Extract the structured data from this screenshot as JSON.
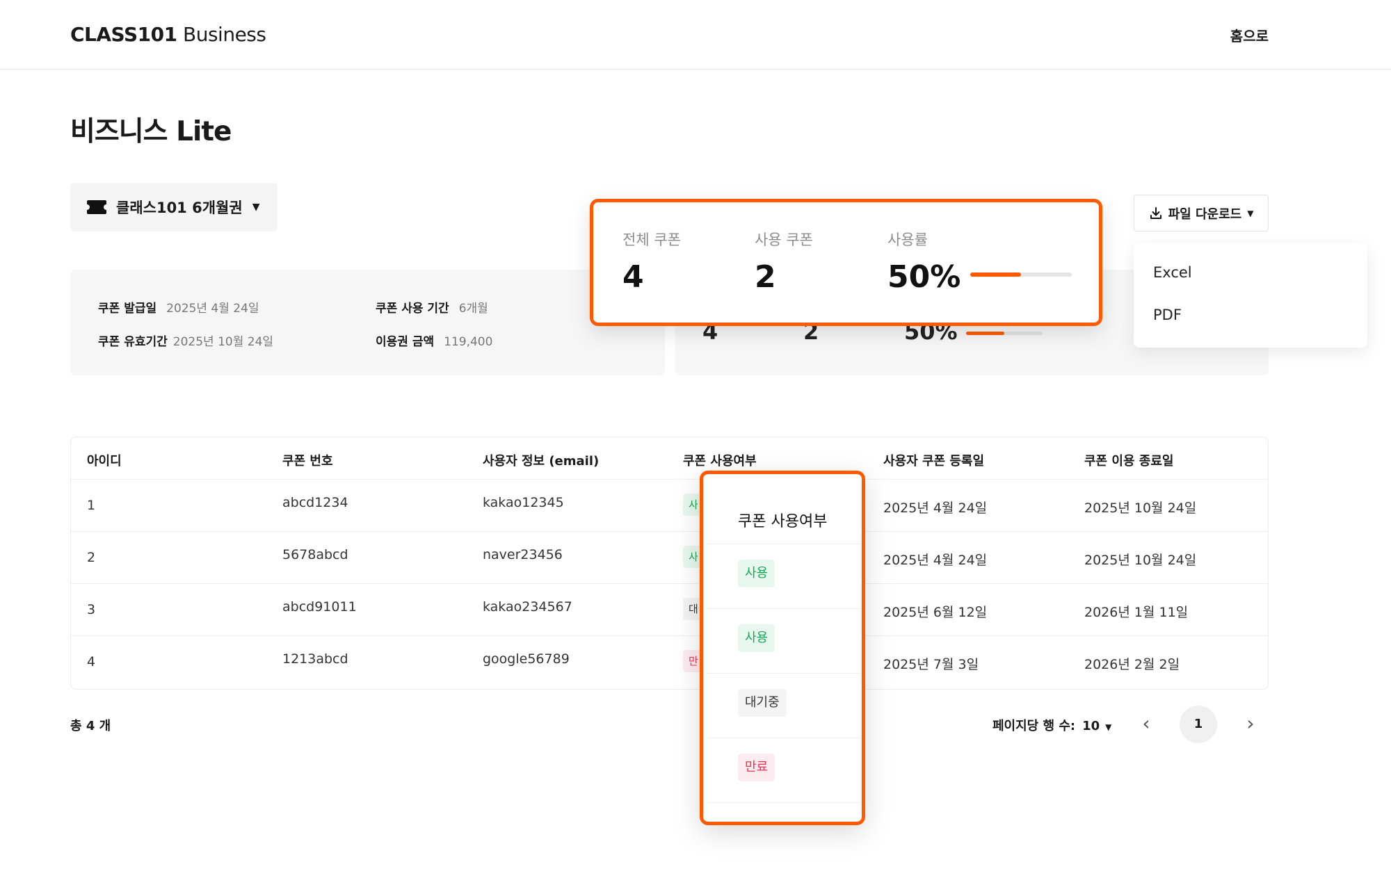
{
  "header": {
    "logo_bold": "CLASS101",
    "logo_light": "Business",
    "home_link": "홈으로"
  },
  "page_title": "비즈니스 Lite",
  "coupon_selector": {
    "label": "클래스101 6개월권"
  },
  "info": {
    "issue_date_label": "쿠폰 발급일",
    "issue_date_value": "2025년 4월 24일",
    "usage_period_label": "쿠폰 사용 기간",
    "usage_period_value": "6개월",
    "valid_until_label": "쿠폰 유효기간",
    "valid_until_value": "2025년 10월 24일",
    "price_label": "이용권 금액",
    "price_value": "119,400"
  },
  "stats": {
    "total_label": "전체 쿠폰",
    "total_value": "4",
    "used_label": "사용 쿠폰",
    "used_value": "2",
    "rate_label": "사용률",
    "rate_value": "50%",
    "rate_fraction": 0.5,
    "accent_color": "#ff5a00"
  },
  "download": {
    "button_label": "파일 다운로드",
    "options": [
      "Excel",
      "PDF"
    ]
  },
  "table": {
    "headers": [
      "아이디",
      "쿠폰 번호",
      "사용자 정보 (email)",
      "쿠폰 사용여부",
      "사용자 쿠폰 등록일",
      "쿠폰 이용 종료일"
    ],
    "rows": [
      {
        "id": "1",
        "code": "abcd1234",
        "email": "kakao12345",
        "status_visible": "사",
        "registered": "2025년 4월 24일",
        "end": "2025년 10월 24일"
      },
      {
        "id": "2",
        "code": "5678abcd",
        "email": "naver23456",
        "status_visible": "사",
        "registered": "2025년 4월 24일",
        "end": "2025년 10월 24일"
      },
      {
        "id": "3",
        "code": "abcd91011",
        "email": "kakao234567",
        "status_visible": "대",
        "registered": "2025년 6월 12일",
        "end": "2026년 1월 11일"
      },
      {
        "id": "4",
        "code": "1213abcd",
        "email": "google56789",
        "status_visible": "만",
        "registered": "2025년 7월 3일",
        "end": "2026년 2월 2일"
      }
    ]
  },
  "footer": {
    "total": "총 4 개",
    "per_page_label": "페이지당 행 수:",
    "per_page_value": "10",
    "current_page": "1"
  },
  "status_popup": {
    "title": "쿠폰 사용여부",
    "chips": [
      {
        "label": "사용",
        "kind": "used"
      },
      {
        "label": "사용",
        "kind": "used"
      },
      {
        "label": "대기중",
        "kind": "wait"
      },
      {
        "label": "만료",
        "kind": "exp"
      }
    ]
  }
}
